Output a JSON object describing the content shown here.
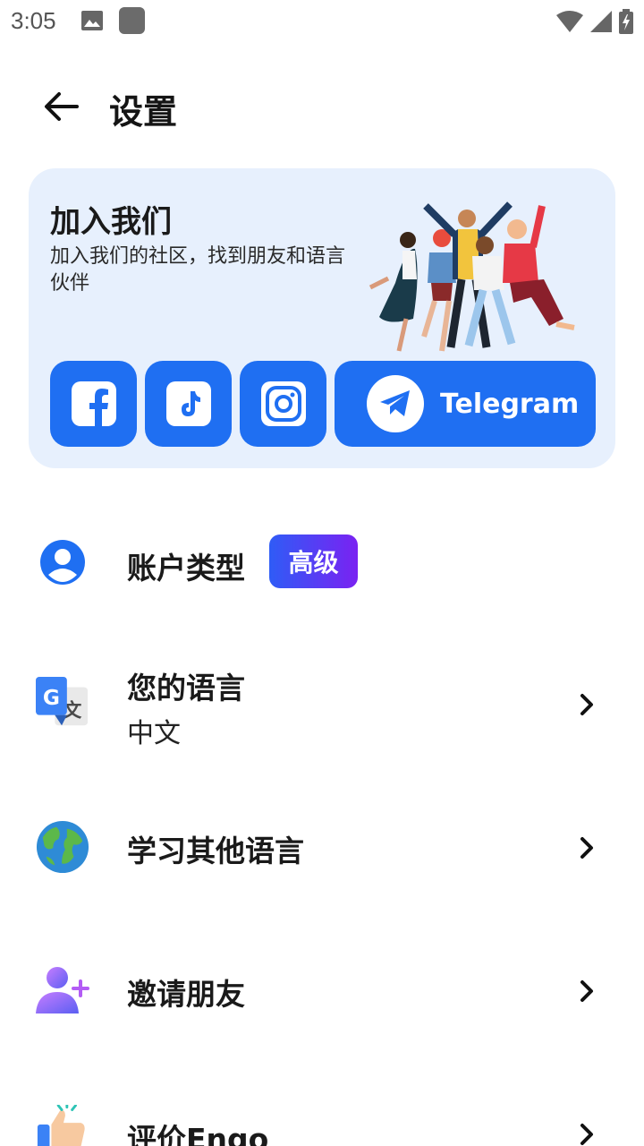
{
  "status_bar": {
    "time": "3:05",
    "icons": [
      "image-icon",
      "app-icon",
      "wifi-icon",
      "signal-icon",
      "battery-charging-icon"
    ]
  },
  "header": {
    "title": "设置",
    "back_icon": "arrow-left-icon"
  },
  "join_card": {
    "title": "加入我们",
    "description": "加入我们的社区，找到朋友和语言伙伴",
    "illustration": "group-of-friends-illustration",
    "socials": [
      {
        "name": "facebook",
        "icon": "facebook-icon"
      },
      {
        "name": "tiktok",
        "icon": "tiktok-icon"
      },
      {
        "name": "instagram",
        "icon": "instagram-icon"
      }
    ],
    "telegram": {
      "label": "Telegram",
      "icon": "telegram-icon"
    },
    "colors": {
      "card_bg": "#e7f0fd",
      "button_bg": "#1f6ff2"
    }
  },
  "menu": {
    "account": {
      "label": "账户类型",
      "badge": "高级",
      "icon": "user-circle-icon"
    },
    "language": {
      "label": "您的语言",
      "value": "中文",
      "icon": "google-translate-icon"
    },
    "learn": {
      "label": "学习其他语言",
      "icon": "globe-icon"
    },
    "invite": {
      "label": "邀请朋友",
      "icon": "add-user-icon"
    },
    "rate": {
      "label": "评价Engo",
      "icon": "thumbs-up-icon"
    }
  }
}
